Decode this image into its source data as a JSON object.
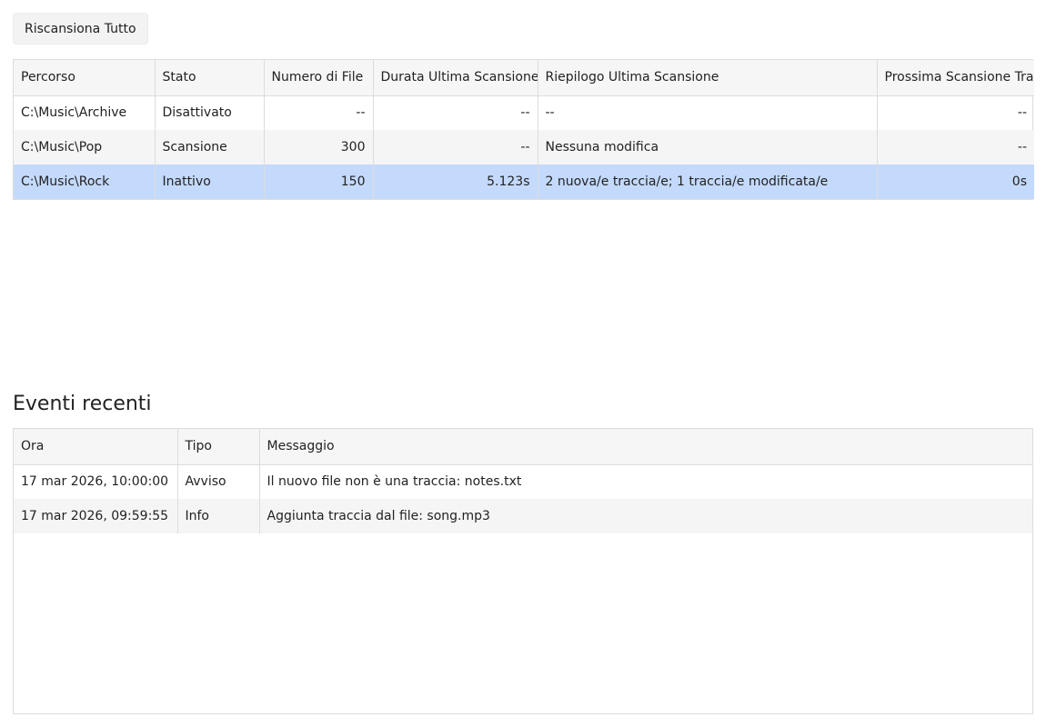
{
  "toolbar": {
    "rescan_all_label": "Riscansiona Tutto"
  },
  "sources": {
    "columns": [
      "Percorso",
      "Stato",
      "Numero di File",
      "Durata Ultima Scansione",
      "Riepilogo Ultima Scansione",
      "Prossima Scansione Tra"
    ],
    "rows": [
      {
        "path": "C:\\Music\\Archive",
        "status": "Disattivato",
        "file_count": "--",
        "last_duration": "--",
        "last_summary": "--",
        "next_scan": "--",
        "selected": false
      },
      {
        "path": "C:\\Music\\Pop",
        "status": "Scansione",
        "file_count": "300",
        "last_duration": "--",
        "last_summary": "Nessuna modifica",
        "next_scan": "--",
        "selected": false
      },
      {
        "path": "C:\\Music\\Rock",
        "status": "Inattivo",
        "file_count": "150",
        "last_duration": "5.123s",
        "last_summary": "2 nuova/e traccia/e; 1 traccia/e modificata/e",
        "next_scan": "0s",
        "selected": true
      }
    ]
  },
  "events": {
    "title": "Eventi recenti",
    "columns": [
      "Ora",
      "Tipo",
      "Messaggio"
    ],
    "rows": [
      {
        "time": "17 mar 2026, 10:00:00",
        "type": "Avviso",
        "message": "Il nuovo file non è una traccia: notes.txt"
      },
      {
        "time": "17 mar 2026, 09:59:55",
        "type": "Info",
        "message": "Aggiunta traccia dal file: song.mp3"
      }
    ]
  },
  "colors": {
    "selected_row": "#c4dafc",
    "header_bg": "#f6f6f7",
    "alt_row": "#f5f5f5",
    "border": "#dcdcdc"
  }
}
